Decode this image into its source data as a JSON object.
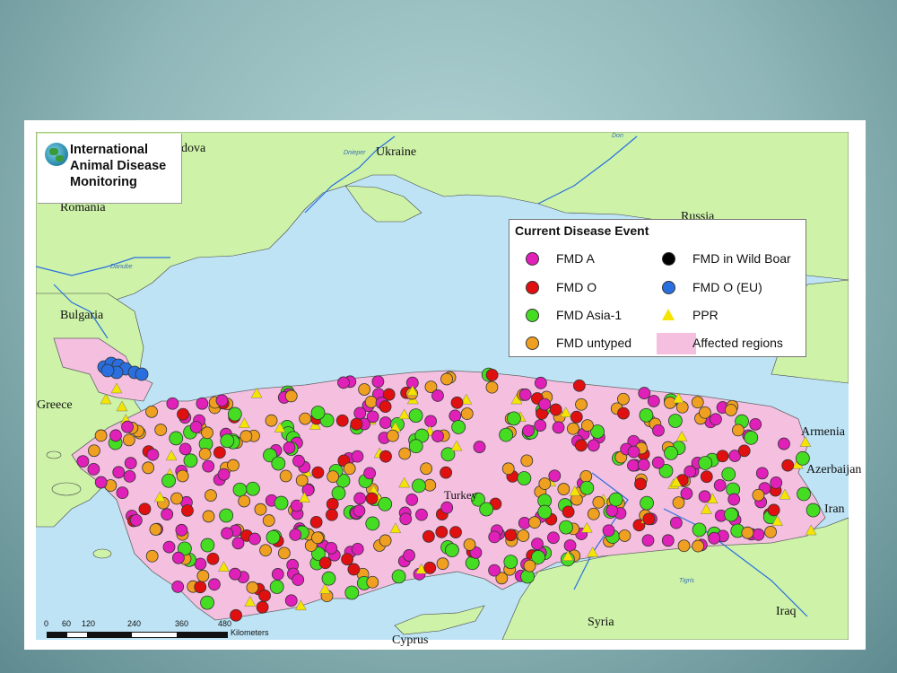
{
  "logo": {
    "lines": [
      "International",
      "Animal Disease",
      "Monitoring"
    ]
  },
  "legend": {
    "title": "Current Disease Event",
    "items": [
      {
        "label": "FMD A",
        "symbol": "circle",
        "color": "#e020b8"
      },
      {
        "label": "FMD in Wild Boar",
        "symbol": "circle",
        "color": "#000000"
      },
      {
        "label": "FMD O",
        "symbol": "circle",
        "color": "#e01010"
      },
      {
        "label": "FMD O (EU)",
        "symbol": "circle",
        "color": "#2a6fe0"
      },
      {
        "label": "FMD Asia-1",
        "symbol": "circle",
        "color": "#44dd22"
      },
      {
        "label": "PPR",
        "symbol": "triangle",
        "color": "#f5e400"
      },
      {
        "label": "FMD untyped",
        "symbol": "circle",
        "color": "#f0a020"
      },
      {
        "label": "Affected regions",
        "symbol": "swatch",
        "color": "#f5bfe0"
      }
    ]
  },
  "places": {
    "moldova": "dova",
    "ukraine": "Ukraine",
    "romania": "Romania",
    "bulgaria": "Bulgaria",
    "greece": "Greece",
    "russia": "Russia",
    "armenia": "Armenia",
    "azerbaijan": "Azerbaijan",
    "iran": "Iran",
    "iraq": "Iraq",
    "syria": "Syria",
    "cyprus": "Cyprus",
    "turkey": "Turkey"
  },
  "rivers": {
    "danube": "Danube",
    "dnieper": "Dnieper",
    "don": "Don",
    "tigris": "Tigris"
  },
  "scale": {
    "ticks": [
      "0",
      "60",
      "120",
      "240",
      "360",
      "480"
    ],
    "unit": "Kilometers"
  },
  "colors": {
    "sea": "#bde3f5",
    "land": "#cdf2a8",
    "affected": "#f5bfe0",
    "river": "#2a6fe0"
  }
}
